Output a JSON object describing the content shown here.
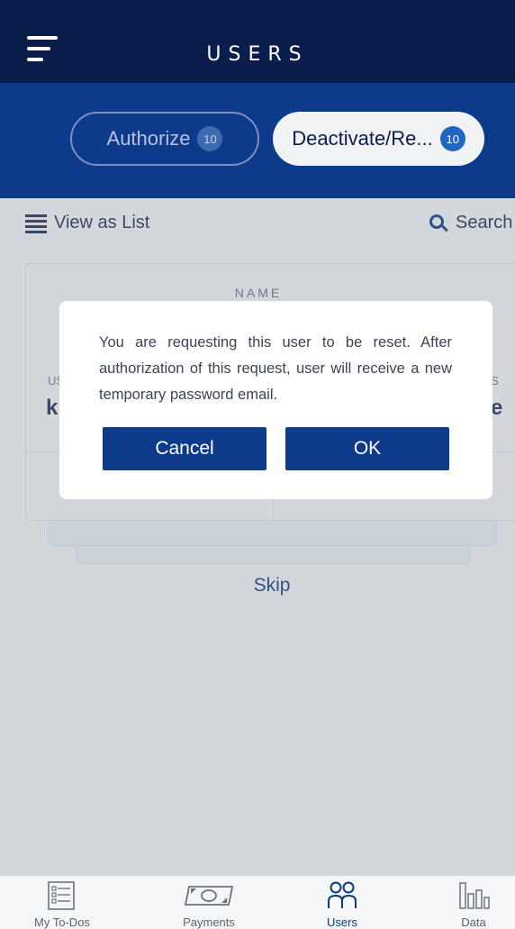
{
  "header": {
    "title": "USERS",
    "menu_icon": "hamburger-icon"
  },
  "segments": [
    {
      "label": "Authorize",
      "count": "10",
      "selected": false
    },
    {
      "label": "Deactivate/Re...",
      "count": "10",
      "selected": true
    }
  ],
  "toolbar": {
    "view_toggle": "View as List",
    "search": "Search"
  },
  "card": {
    "name_label": "NAME",
    "user_label": "US",
    "user_value": "k",
    "status_label": "S",
    "status_value": "e"
  },
  "skip": "Skip",
  "dialog": {
    "message": "You are requesting this user to be reset. After authorization of this request, user will receive a new temporary password email.",
    "cancel": "Cancel",
    "ok": "OK"
  },
  "bottom_nav": [
    {
      "label": "My To-Dos",
      "icon": "todo-list-icon",
      "active": false
    },
    {
      "label": "Payments",
      "icon": "banknote-icon",
      "active": false
    },
    {
      "label": "Users",
      "icon": "users-icon",
      "active": true
    },
    {
      "label": "Data",
      "icon": "bar-chart-icon",
      "active": false
    }
  ],
  "colors": {
    "header": "#0b1d4a",
    "segment_bar": "#0d3a8a",
    "badge": "#2166c7",
    "button": "#0d3a8a",
    "nav_active": "#0b3a85"
  }
}
